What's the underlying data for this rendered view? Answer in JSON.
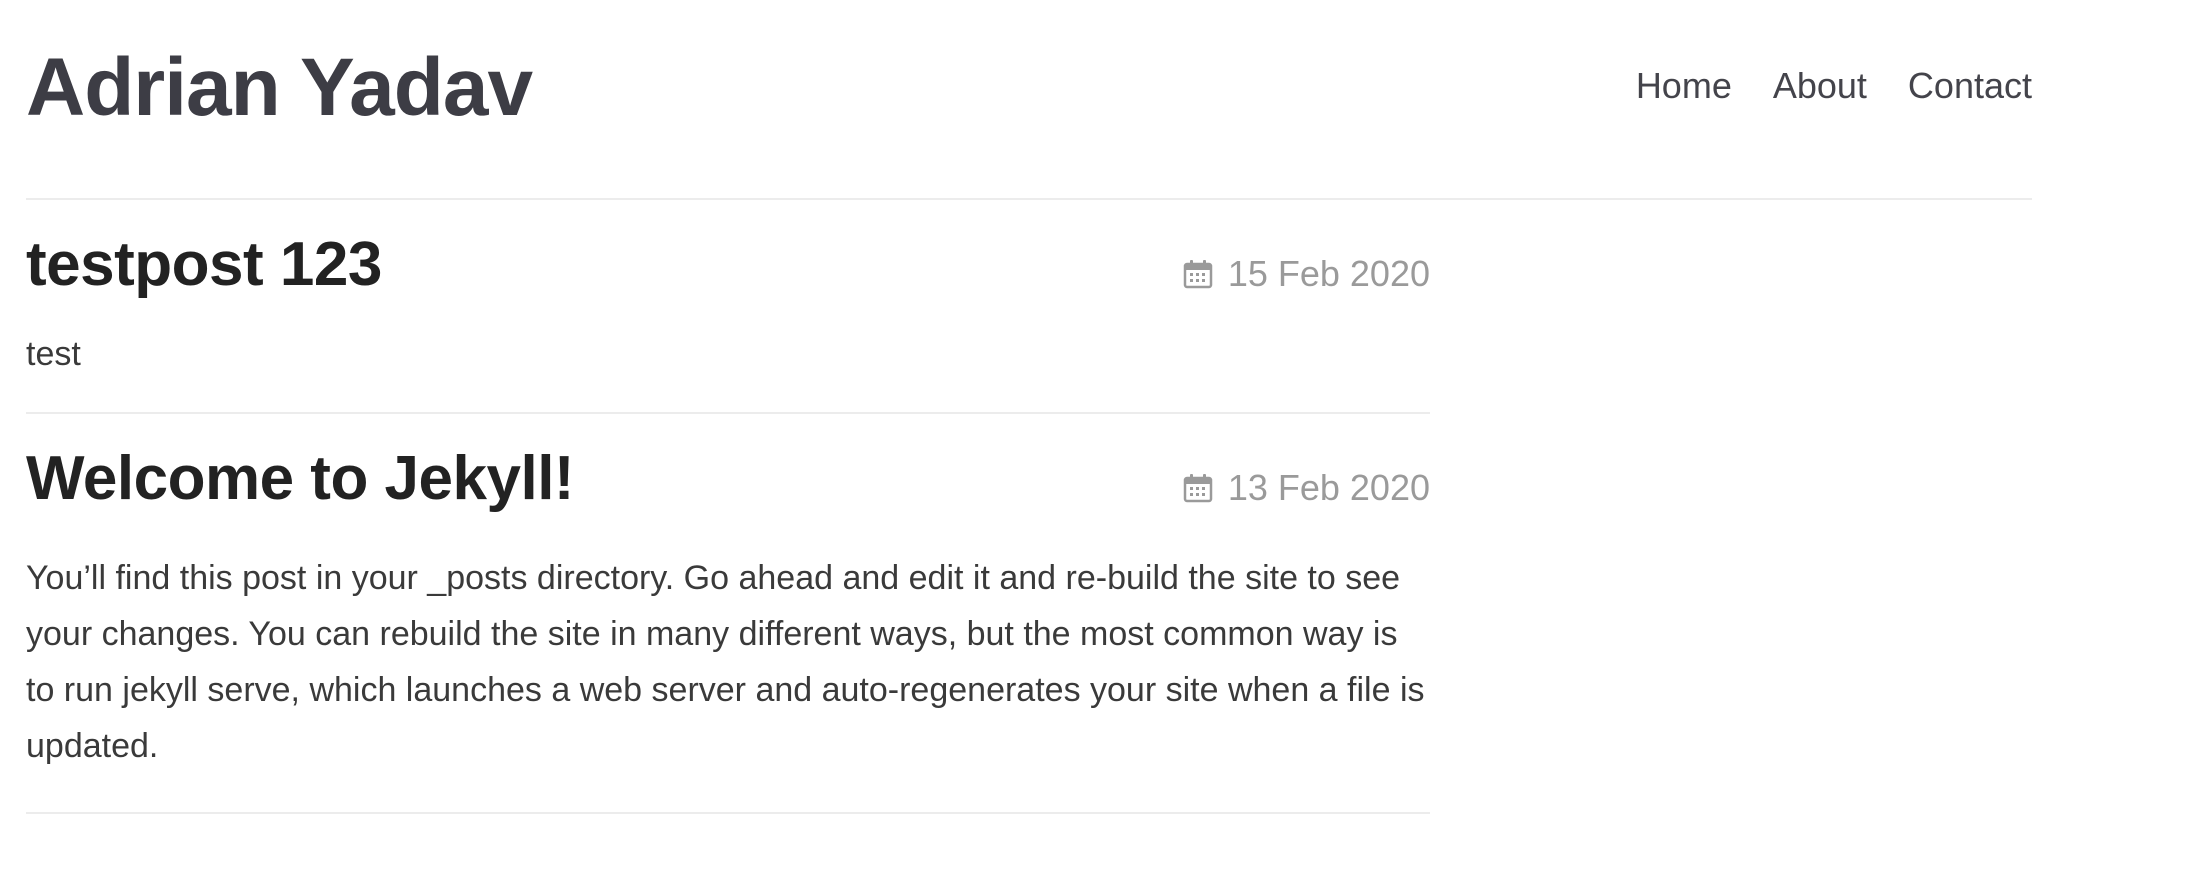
{
  "site": {
    "title": "Adrian Yadav"
  },
  "nav": {
    "items": [
      {
        "label": "Home"
      },
      {
        "label": "About"
      },
      {
        "label": "Contact"
      }
    ]
  },
  "posts": [
    {
      "title": "testpost 123",
      "date": "15 Feb 2020",
      "excerpt": "test"
    },
    {
      "title": "Welcome to Jekyll!",
      "date": "13 Feb 2020",
      "excerpt": "You’ll find this post in your _posts directory. Go ahead and edit it and re-build the site to see your changes. You can rebuild the site in many different ways, but the most common way is to run jekyll serve, which launches a web server and auto-regenerates your site when a file is updated."
    }
  ],
  "colors": {
    "title": "#3d3d45",
    "post_title": "#222222",
    "date": "#9a9a9a",
    "divider": "#ececec"
  },
  "icons": {
    "date_icon": "calendar-icon"
  }
}
